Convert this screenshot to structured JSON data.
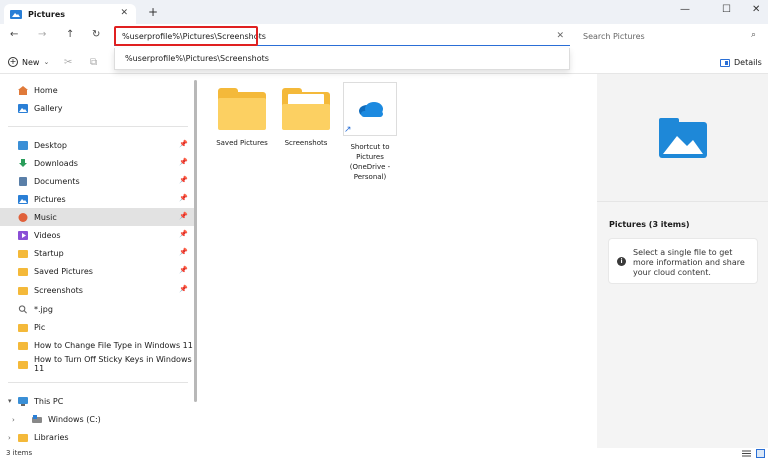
{
  "tab": {
    "title": "Pictures",
    "close": "✕",
    "new_tab": "+"
  },
  "window_controls": {
    "minimize": "—",
    "maximize": "☐",
    "close": "✕"
  },
  "nav": {
    "back": "←",
    "forward": "→",
    "up": "↑",
    "refresh": "↻"
  },
  "address": {
    "value": "%userprofile%\\Pictures\\Screenshots",
    "clear": "✕"
  },
  "search": {
    "placeholder": "Search Pictures",
    "icon": "⌕"
  },
  "toolbar": {
    "new_label": "New",
    "new_chevron": "⌄",
    "details_label": "Details"
  },
  "suggestion": "%userprofile%\\Pictures\\Screenshots",
  "sidebar": {
    "items": [
      {
        "label": "Home",
        "icon": "home-icon"
      },
      {
        "label": "Gallery",
        "icon": "gallery-icon"
      },
      {
        "label": "Desktop",
        "icon": "desktop-icon",
        "pinned": true
      },
      {
        "label": "Downloads",
        "icon": "downloads-icon",
        "pinned": true
      },
      {
        "label": "Documents",
        "icon": "documents-icon",
        "pinned": true
      },
      {
        "label": "Pictures",
        "icon": "pictures-icon",
        "pinned": true
      },
      {
        "label": "Music",
        "icon": "music-icon",
        "pinned": true,
        "selected": true
      },
      {
        "label": "Videos",
        "icon": "videos-icon",
        "pinned": true
      },
      {
        "label": "Startup",
        "icon": "folder-icon",
        "pinned": true
      },
      {
        "label": "Saved Pictures",
        "icon": "folder-icon",
        "pinned": true
      },
      {
        "label": "Screenshots",
        "icon": "folder-icon",
        "pinned": true
      },
      {
        "label": "*.jpg",
        "icon": "search-icon"
      },
      {
        "label": "Pic",
        "icon": "folder-icon"
      },
      {
        "label": "How to Change File Type in Windows 11",
        "icon": "folder-icon"
      },
      {
        "label": "How to Turn Off Sticky Keys in Windows 11",
        "icon": "folder-icon"
      },
      {
        "label": "This PC",
        "icon": "pc-icon"
      },
      {
        "label": "Windows (C:)",
        "icon": "drive-icon"
      },
      {
        "label": "Libraries",
        "icon": "folder-icon"
      }
    ],
    "pin_glyph": "📌"
  },
  "files": [
    {
      "label": "Saved Pictures",
      "type": "folder"
    },
    {
      "label": "Screenshots",
      "type": "folder"
    },
    {
      "label": "Shortcut to Pictures (OneDrive - Personal)",
      "type": "shortcut"
    }
  ],
  "details_pane": {
    "title": "Pictures (3 items)",
    "info": "Select a single file to get more information and share your cloud content.",
    "info_glyph": "i"
  },
  "status": {
    "count": "3 items"
  },
  "colors": {
    "accent": "#2a6fd6",
    "highlight_box": "#e02020",
    "folder": "#f4b93a",
    "selected_row": "#e2e2e2"
  }
}
